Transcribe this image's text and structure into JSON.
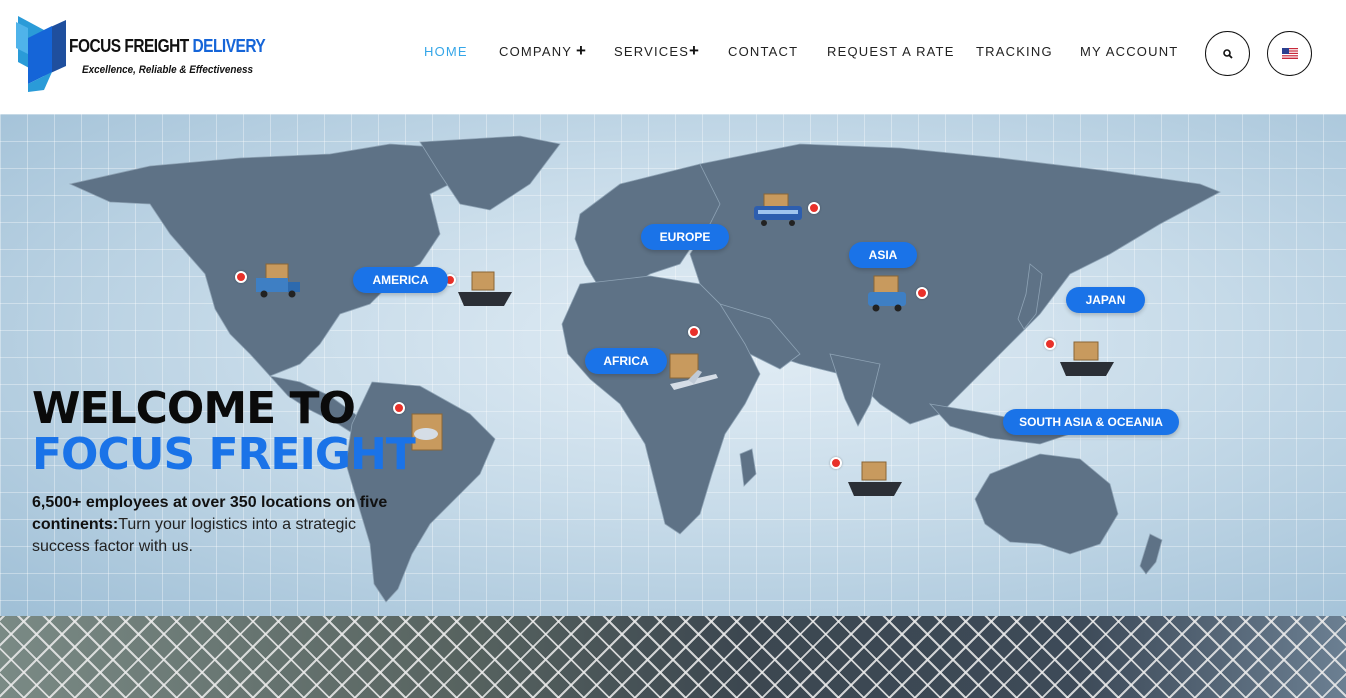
{
  "brand": {
    "name_part1": "FOCUS FREIGHT ",
    "name_part2": "DELIVERY",
    "tagline": "Excellence, Reliable & Effectiveness",
    "accent_color": "#1565d8"
  },
  "nav": {
    "items": [
      "HOME",
      "COMPANY",
      "SERVICES",
      "CONTACT",
      "REQUEST A RATE",
      "TRACKING",
      "MY ACCOUNT"
    ],
    "active": "HOME",
    "active_color": "#35a6e8",
    "expandable_marker": "+"
  },
  "actions": {
    "search_icon": "search-icon",
    "language_icon": "us-flag-icon"
  },
  "hero": {
    "regions": [
      "AMERICA",
      "EUROPE",
      "ASIA",
      "JAPAN",
      "AFRICA",
      "SOUTH ASIA & OCEANIA"
    ],
    "headline_line1": "WELCOME TO",
    "headline_line2": "FOCUS FREIGHT",
    "sub_bold": "6,500+ employees at over 350 locations on five continents:",
    "sub_text": "Turn your logistics into a strategic success factor with us.",
    "pill_color": "#1a73e8",
    "marker_color": "#e8312a"
  }
}
